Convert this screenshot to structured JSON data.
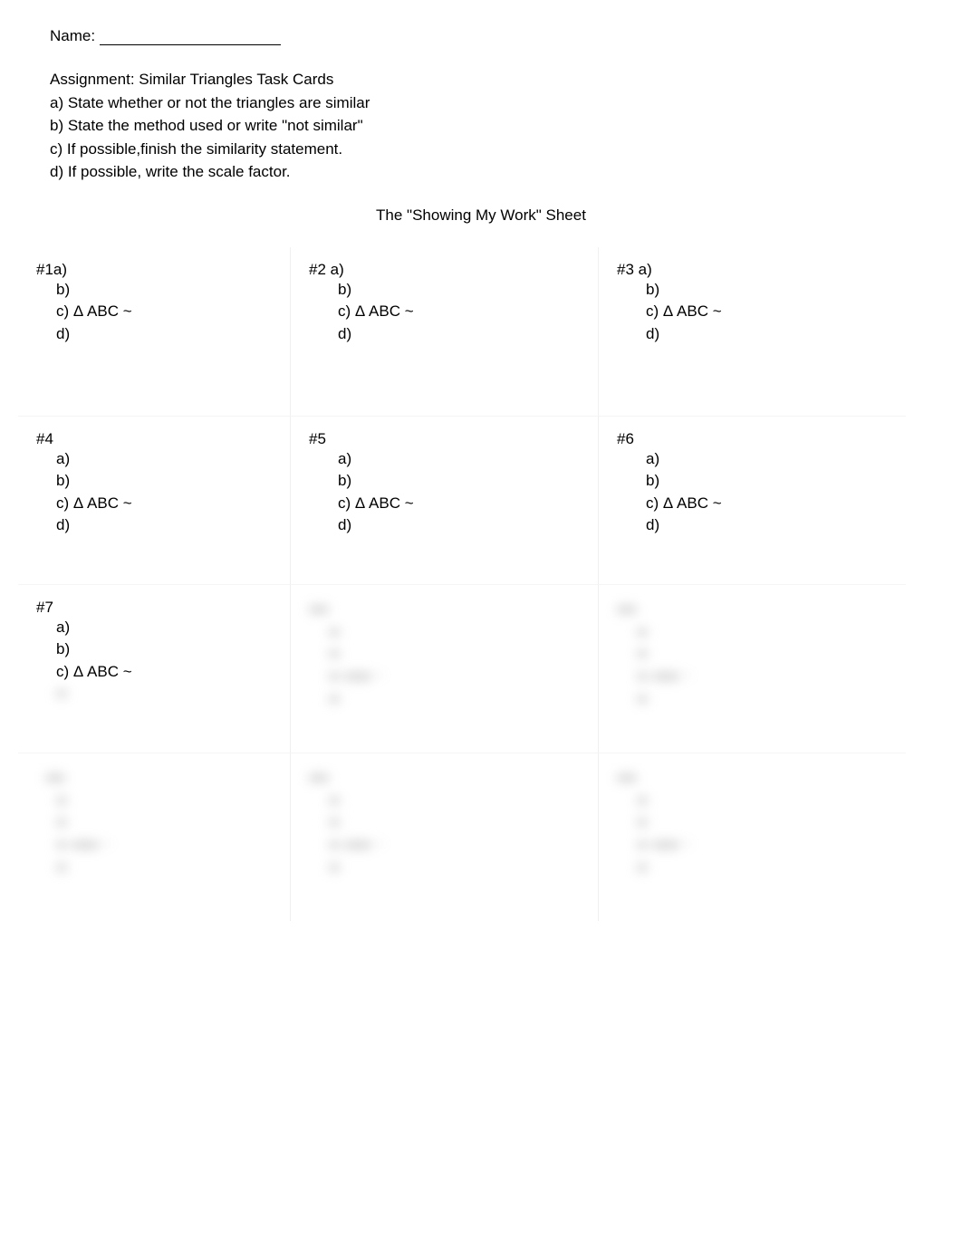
{
  "header": {
    "name_label": "Name:"
  },
  "assignment": {
    "title": "Assignment: Similar Triangles Task Cards",
    "a": "a)  State whether or not the triangles are similar",
    "b": "b)  State the method used or write \"not similar\"",
    "c": "c)  If possible,finish the similarity statement.",
    "d": "d)  If possible, write the scale factor."
  },
  "sheet_title": "The \"Showing My Work\" Sheet",
  "cells": {
    "q1": {
      "head": "#1a)",
      "b": "b)",
      "c": "c) Δ ABC ~",
      "d": "d)"
    },
    "q2": {
      "head": "#2 a)",
      "b": "b)",
      "c": "c) Δ ABC ~",
      "d": "d)"
    },
    "q3": {
      "head": "#3 a)",
      "b": "b)",
      "c": "c) Δ ABC ~",
      "d": "d)"
    },
    "q4": {
      "head": "#4",
      "a": "a)",
      "b": "b)",
      "c": "c) Δ ABC ~",
      "d": "d)"
    },
    "q5": {
      "head": "#5",
      "a": "a)",
      "b": "b)",
      "c": "c) Δ ABC ~",
      "d": "d)"
    },
    "q6": {
      "head": "#6",
      "a": "a)",
      "b": "b)",
      "c": "c) Δ ABC ~",
      "d": "d)"
    },
    "q7": {
      "head": "#7",
      "a": "a)",
      "b": "b)",
      "c": "c) Δ ABC ~"
    }
  }
}
